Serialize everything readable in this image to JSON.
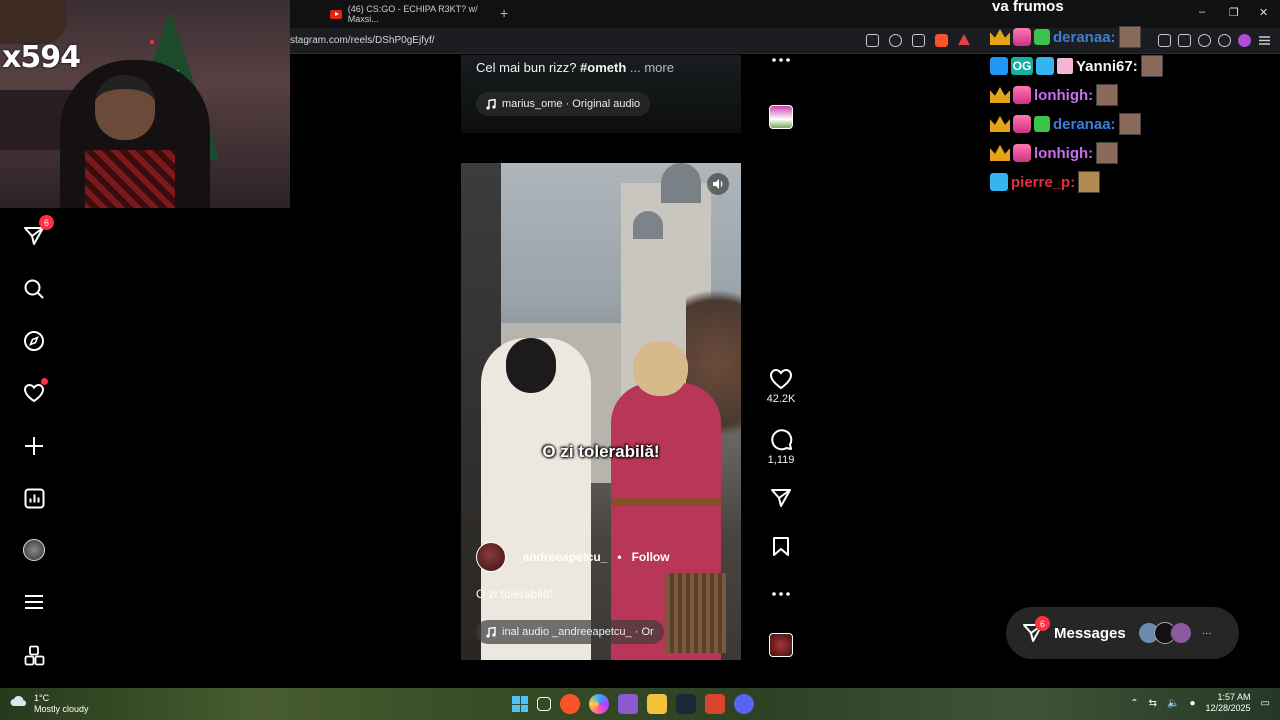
{
  "browser": {
    "tab_title": "(46) CS:GO - ECHIPA R3KT? w/ Maxsi...",
    "url": "stagram.com/reels/DShP0gEjfyf/",
    "new_tab": "+",
    "win_minimize": "–",
    "win_restore": "❐",
    "win_close": "✕"
  },
  "stream_overlay": {
    "cam_tag": "x594",
    "chat_title": "va frumos",
    "chat_lines": [
      {
        "user": "deranaa:",
        "color": "#3b7ed8"
      },
      {
        "user": "Yanni67:",
        "color": "#f4f4f4"
      },
      {
        "user": "lonhigh:",
        "color": "#c86ef0"
      },
      {
        "user": "deranaa:",
        "color": "#3b7ed8"
      },
      {
        "user": "lonhigh:",
        "color": "#c86ef0"
      },
      {
        "user": "pierre_p:",
        "color": "#e0303e"
      }
    ]
  },
  "sidebar": {
    "messages_badge": "6",
    "items": [
      {
        "icon": "direct-send-icon"
      },
      {
        "icon": "search-icon"
      },
      {
        "icon": "explore-compass-icon"
      },
      {
        "icon": "heart-notifications-icon"
      },
      {
        "icon": "create-plus-icon"
      },
      {
        "icon": "dashboard-chart-icon"
      },
      {
        "icon": "profile-avatar"
      },
      {
        "icon": "menu-icon"
      },
      {
        "icon": "more-apps-icon"
      }
    ]
  },
  "previous_reel": {
    "caption_prefix": "Cel mai bun rizz? ",
    "caption_tag": "#ometh",
    "caption_more": "... more",
    "audio": "marius_ome · Original audio"
  },
  "reel": {
    "subtitle": "O zi tolerabilă!",
    "author": "_andreeapetcu_",
    "separator": "•",
    "follow": "Follow",
    "caption": "O zi tolerabilă!",
    "audio": "inal audio  _andreeapetcu_ · Or",
    "likes": "42.2K",
    "comments": "1,119"
  },
  "messages_bar": {
    "label": "Messages",
    "badge": "6",
    "more": "···"
  },
  "taskbar": {
    "temperature": "1°C",
    "weather": "Mostly cloudy",
    "time": "1:57 AM",
    "date": "12/28/2025"
  },
  "colors": {
    "accent_red": "#ff3040",
    "background": "#000000",
    "pill": "#262626"
  }
}
